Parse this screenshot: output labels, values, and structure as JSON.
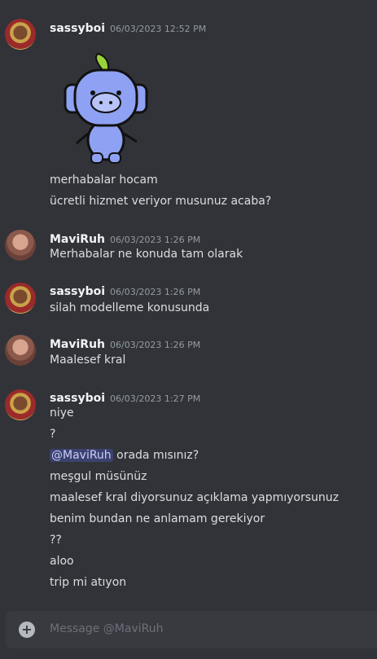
{
  "messages": [
    {
      "author": "sassyboi",
      "timestamp": "06/03/2023 12:52 PM",
      "sticker": "wumpus-sticker",
      "lines": [
        "merhabalar hocam",
        "ücretli hizmet veriyor musunuz acaba?"
      ]
    },
    {
      "author": "MaviRuh",
      "timestamp": "06/03/2023 1:26 PM",
      "lines": [
        "Merhabalar ne konuda tam olarak"
      ]
    },
    {
      "author": "sassyboi",
      "timestamp": "06/03/2023 1:26 PM",
      "lines": [
        "silah modelleme konusunda"
      ]
    },
    {
      "author": "MaviRuh",
      "timestamp": "06/03/2023 1:26 PM",
      "lines": [
        "Maalesef kral"
      ]
    },
    {
      "author": "sassyboi",
      "timestamp": "06/03/2023 1:27 PM",
      "lines": [
        "niye",
        "?",
        "orada mısınız?",
        "meşgul müsünüz",
        "maalesef kral diyorsunuz açıklama yapmıyorsunuz",
        "benim bundan ne anlamam gerekiyor",
        "??",
        "aloo",
        "trip mi atıyon"
      ],
      "mention": "@MaviRuh"
    }
  ],
  "composer": {
    "placeholder": "Message @MaviRuh",
    "attach_icon": "plus-circle-icon"
  },
  "colors": {
    "background": "#313338",
    "mention_bg": "#3c4270",
    "composer_bg": "#383a40"
  }
}
